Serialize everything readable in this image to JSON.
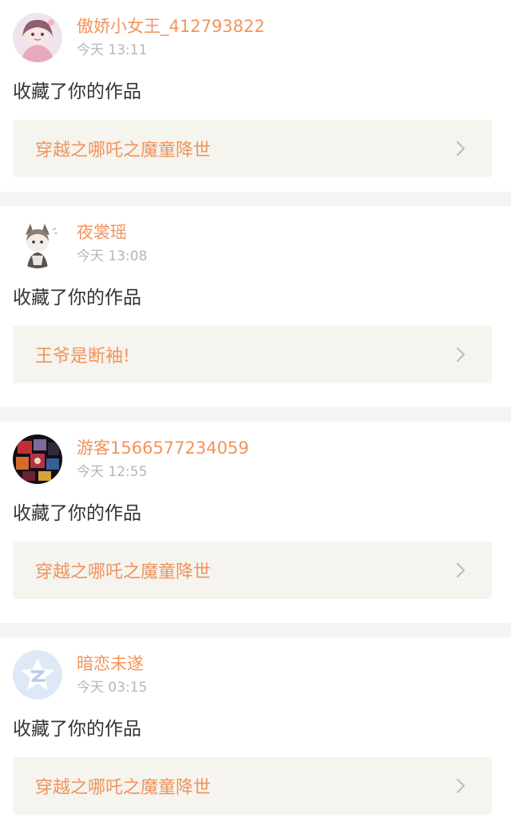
{
  "items": [
    {
      "name": "傲娇小女王_412793822",
      "time": "今天 13:11",
      "action": "收藏了你的作品",
      "work": "穿越之哪吒之魔童降世",
      "avatar_icon": "anime-girl-avatar-icon"
    },
    {
      "name": "夜裳瑶",
      "time": "今天 13:08",
      "action": "收藏了你的作品",
      "work": "王爷是断袖!",
      "avatar_icon": "chibi-character-avatar-icon"
    },
    {
      "name": "游客1566577234059",
      "time": "今天 12:55",
      "action": "收藏了你的作品",
      "work": "穿越之哪吒之魔童降世",
      "avatar_icon": "dark-collage-avatar-icon"
    },
    {
      "name": "暗恋未遂",
      "time": "今天 03:15",
      "action": "收藏了你的作品",
      "work": "穿越之哪吒之魔童降世",
      "avatar_icon": "qzone-star-avatar-icon"
    }
  ],
  "colors": {
    "accent": "#f0945c",
    "time": "#b6b6b6",
    "work_bg": "#f5f4ee",
    "divider": "#f4f4f4"
  }
}
